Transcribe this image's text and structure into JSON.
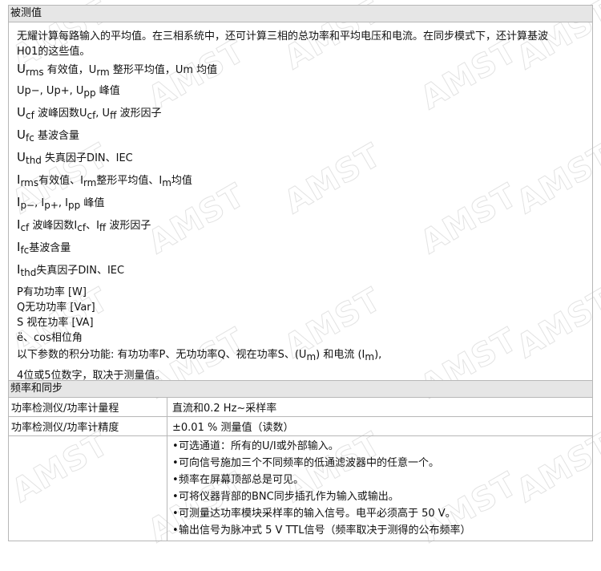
{
  "measured": {
    "title": "被测值",
    "intro": [
      "无耀计算每路输入的平均值。在三相系统中，还可计算三相的总功率和平均电压和电流。在同步模式下，还计算基波",
      "H01的这些值。"
    ],
    "u_rms": {
      "a": "U",
      "b": "rms",
      "c": " 有效值，U",
      "d": "rm",
      "e": " 整形平均值，Um 均值"
    },
    "u_p": {
      "a": "Up−, Up+, U",
      "b": "pp",
      "c": " 峰值"
    },
    "u_cf": {
      "a": "U",
      "b": "cf",
      "c": " 波峰因数U",
      "d": "cf",
      "e": ", U",
      "f": "ff",
      "g": " 波形因子"
    },
    "u_fc": {
      "a": "U",
      "b": "fc",
      "c": " 基波含量"
    },
    "u_thd": {
      "a": "U",
      "b": "thd",
      "c": " 失真因子DIN、IEC"
    },
    "i_rms": {
      "a": "I",
      "b": "rms",
      "c": "有效值、I",
      "d": "rm",
      "e": "整形平均值、I",
      "f": "m",
      "g": "均值"
    },
    "i_p": {
      "a": "I",
      "b": "p−",
      "c": ", I",
      "d": "p+",
      "e": ", I",
      "f": "pp",
      "g": " 峰值"
    },
    "i_cf": {
      "a": "I",
      "b": "cf",
      "c": " 波峰因数I",
      "d": "cf",
      "e": "、I",
      "f": "ff",
      "g": " 波形因子"
    },
    "i_fc": {
      "a": "I",
      "b": "fc",
      "c": "基波含量"
    },
    "i_thd": {
      "a": "I",
      "b": "thd",
      "c": "失真因子DIN、IEC"
    },
    "p": "P有功功率 [W]",
    "q": "Q无功功率 [Var]",
    "s": "S 视在功率 [VA]",
    "phi": "ё、cos相位角",
    "integral": {
      "a": "以下参数的积分功能: 有功功率P、无功功率Q、视在功率S、(U",
      "b": "m",
      "c": ") 和电流 (I",
      "d": "m",
      "e": "),"
    },
    "digits": "4位或5位数字，取决于测量值。"
  },
  "frequency": {
    "title": "频率和同步",
    "rows": [
      {
        "label": "功率检测仪/功率计量程",
        "value": "直流和0.2 Hz~采样率"
      },
      {
        "label": "功率检测仪/功率计精度",
        "value": "±0.01 % 测量值（读数）"
      }
    ],
    "bullets": [
      "可选通道：所有的U/I或外部输入。",
      "可向信号施加三个不同频率的低通滤波器中的任意一个。",
      "频率在屏幕顶部总是可见。",
      "可将仪器背部的BNC同步插孔作为输入或输出。",
      "可测量达功率模块采样率的输入信号。电平必须高于 50 V。",
      "输出信号为脉冲式 5 V TTL信号（频率取决于测得的公布频率）"
    ]
  },
  "watermark": "AMST"
}
